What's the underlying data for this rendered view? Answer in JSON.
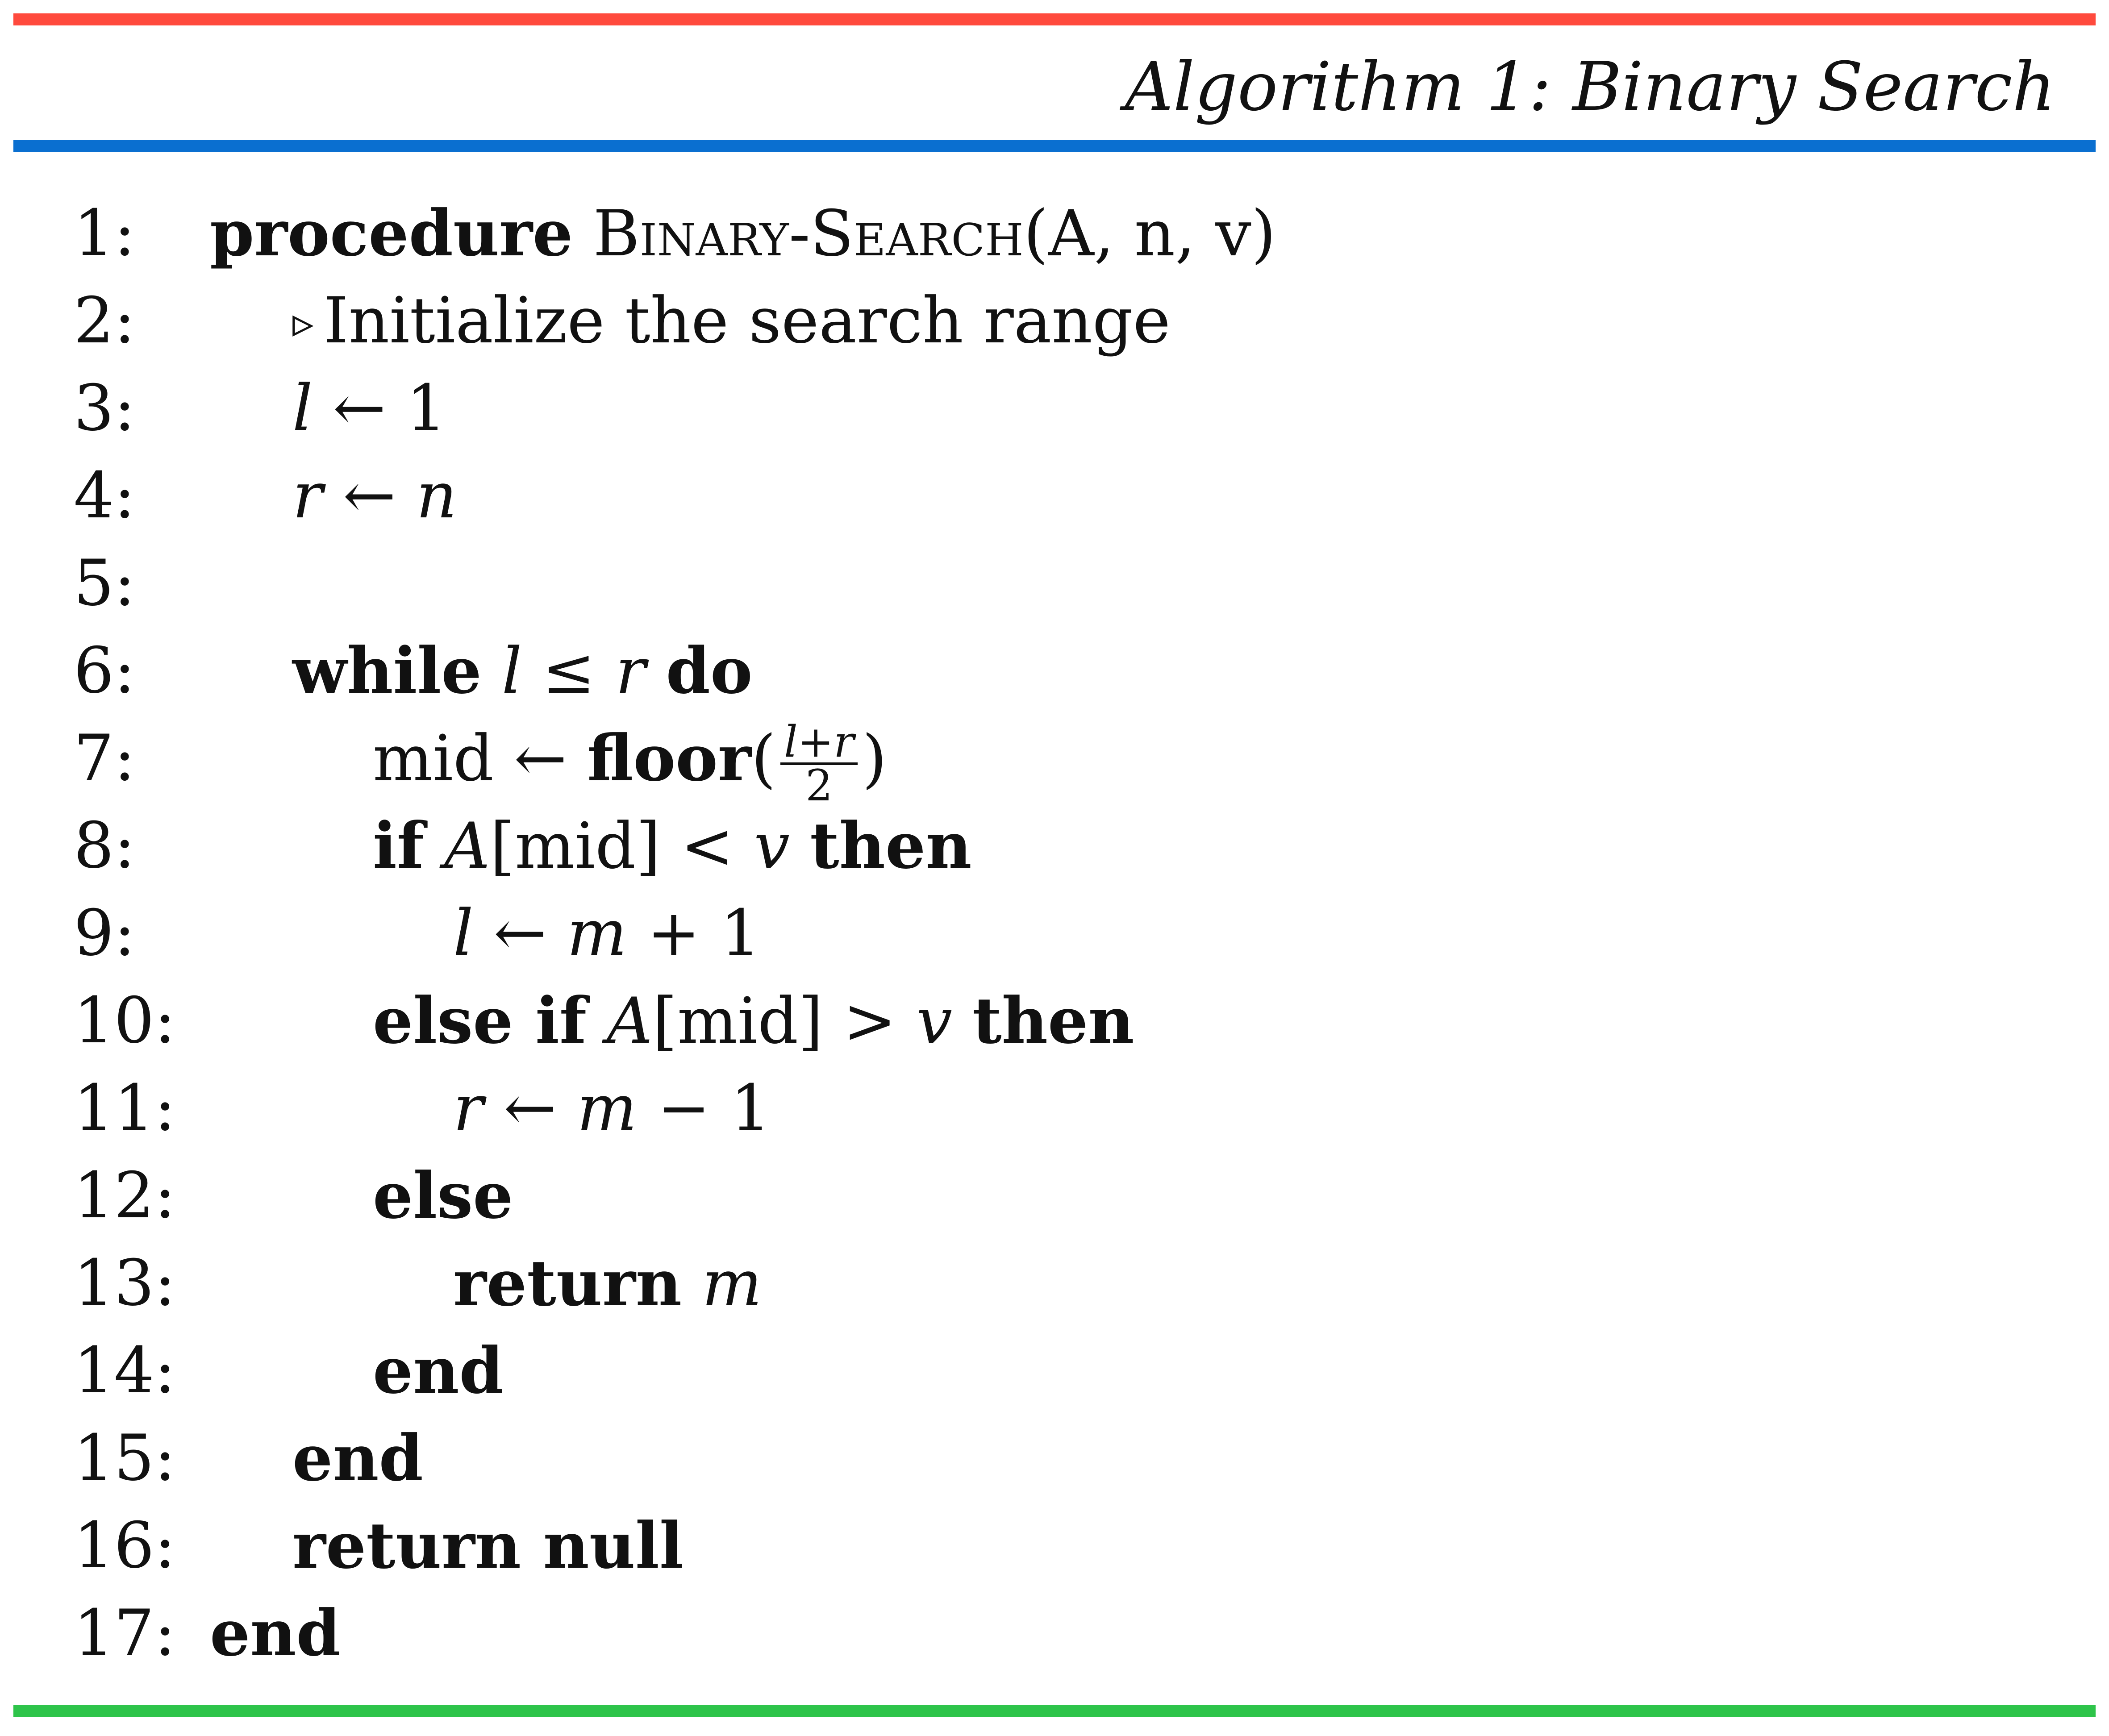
{
  "title": "Algorithm 1: Binary Search",
  "lines": [
    {
      "no": "1:",
      "parts": {
        "kw": "procedure",
        "name": "Binary-Search",
        "args": "(A, n, v)"
      }
    },
    {
      "no": "2:",
      "parts": {
        "comment_marker": "▹",
        "comment": "Initialize the search range"
      }
    },
    {
      "no": "3:",
      "parts": {
        "lhs": "l",
        "op": "←",
        "rhs": "1"
      }
    },
    {
      "no": "4:",
      "parts": {
        "lhs": "r",
        "op": "←",
        "rhs": "n"
      }
    },
    {
      "no": "5:",
      "parts": {}
    },
    {
      "no": "6:",
      "parts": {
        "kw1": "while",
        "a": "l",
        "op": "≤",
        "b": "r",
        "kw2": "do"
      }
    },
    {
      "no": "7:",
      "parts": {
        "lhs": "mid",
        "op": "←",
        "fn": "floor",
        "lp": "(",
        "frac_num": "l+r",
        "frac_den": "2",
        "rp": ")"
      }
    },
    {
      "no": "8:",
      "parts": {
        "kw1": "if",
        "arr": "A",
        "idx": "[mid]",
        "op": "<",
        "b": "v",
        "kw2": "then"
      }
    },
    {
      "no": "9:",
      "parts": {
        "lhs": "l",
        "op": "←",
        "rhs_var": "m",
        "rhs_op": "+",
        "rhs_num": "1"
      }
    },
    {
      "no": "10:",
      "parts": {
        "kw1": "else if",
        "arr": "A",
        "idx": "[mid]",
        "op": ">",
        "b": "v",
        "kw2": "then"
      }
    },
    {
      "no": "11:",
      "parts": {
        "lhs": "r",
        "op": "←",
        "rhs_var": "m",
        "rhs_op": "−",
        "rhs_num": "1"
      }
    },
    {
      "no": "12:",
      "parts": {
        "kw": "else"
      }
    },
    {
      "no": "13:",
      "parts": {
        "kw": "return",
        "val": "m"
      }
    },
    {
      "no": "14:",
      "parts": {
        "kw": "end"
      }
    },
    {
      "no": "15:",
      "parts": {
        "kw": "end"
      }
    },
    {
      "no": "16:",
      "parts": {
        "kw": "return null"
      }
    },
    {
      "no": "17:",
      "parts": {
        "kw": "end"
      }
    }
  ]
}
